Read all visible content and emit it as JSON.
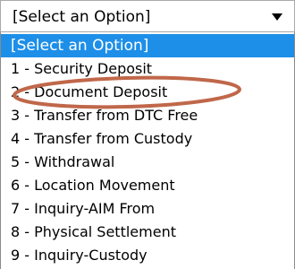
{
  "select": {
    "value": "[Select an Option]",
    "arrow_icon": "triangle-down-icon"
  },
  "options": [
    "[Select an Option]",
    "1 - Security Deposit",
    "2 - Document Deposit",
    "3 - Transfer from DTC Free",
    "4 - Transfer from Custody",
    "5 - Withdrawal",
    "6 - Location Movement",
    "7 - Inquiry-AIM From",
    "8 - Physical Settlement",
    "9 - Inquiry-Custody"
  ],
  "selected_index": 0,
  "annotation": {
    "shape": "ellipse",
    "color": "#c0674a",
    "target_index": 2
  },
  "colors": {
    "selected_bg": "#1e8fe8",
    "selected_text": "#ffffff"
  }
}
